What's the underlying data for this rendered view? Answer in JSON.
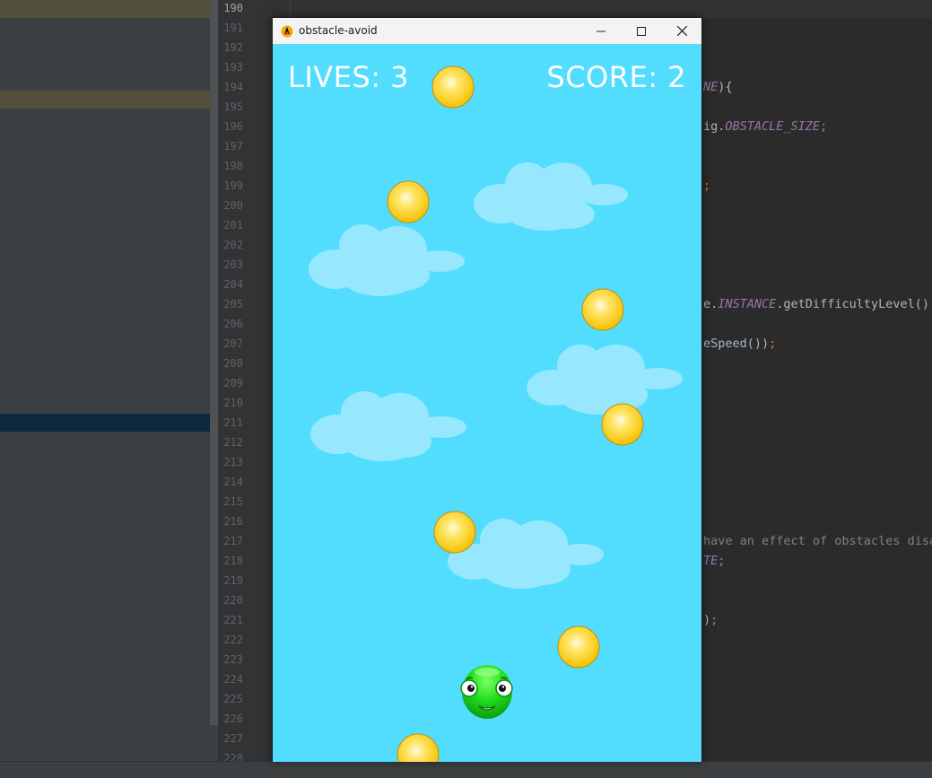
{
  "ide": {
    "line_numbers": [
      "190",
      "191",
      "192",
      "193",
      "194",
      "195",
      "196",
      "197",
      "198",
      "199",
      "200",
      "201",
      "202",
      "203",
      "204",
      "205",
      "206",
      "207",
      "208",
      "209",
      "210",
      "211",
      "212",
      "213",
      "214",
      "215",
      "216",
      "217",
      "218",
      "219",
      "220",
      "221",
      "222",
      "223",
      "224",
      "225",
      "226",
      "227",
      "228"
    ],
    "code_fragments": {
      "l194_a": "NE",
      "l194_b": "){",
      "l196_a": "ig.",
      "l196_b": "OBSTACLE_SIZE",
      "l196_c": ";",
      "l199": ";",
      "l205_a": "e.",
      "l205_b": "INSTANCE",
      "l205_c": ".getDifficultyLevel()",
      "l205_d": ";",
      "l207_a": "eSpeed())",
      "l207_b": ";",
      "l217": "have an effect of obstacles disa",
      "l218_a": "TE",
      "l218_b": ";",
      "l221_a": ")",
      "l221_b": ";"
    },
    "colors": {
      "editor_bg": "#2b2b2b",
      "panel_bg": "#3c3f41",
      "keyword": "#cc7832",
      "constant": "#9876aa"
    }
  },
  "window": {
    "title": "obstacle-avoid",
    "icons": {
      "app": "duke-java-icon",
      "minimize": "minimize-icon",
      "maximize": "maximize-icon",
      "close": "close-icon"
    }
  },
  "game": {
    "lives_label": "LIVES: 3",
    "score_label": "SCORE: 2",
    "lives": 3,
    "score": 2,
    "sky_color": "#52ddff",
    "cloud_color": "#97e8ff",
    "coin_color": "#ffd500",
    "player_color": "#22e01e"
  }
}
